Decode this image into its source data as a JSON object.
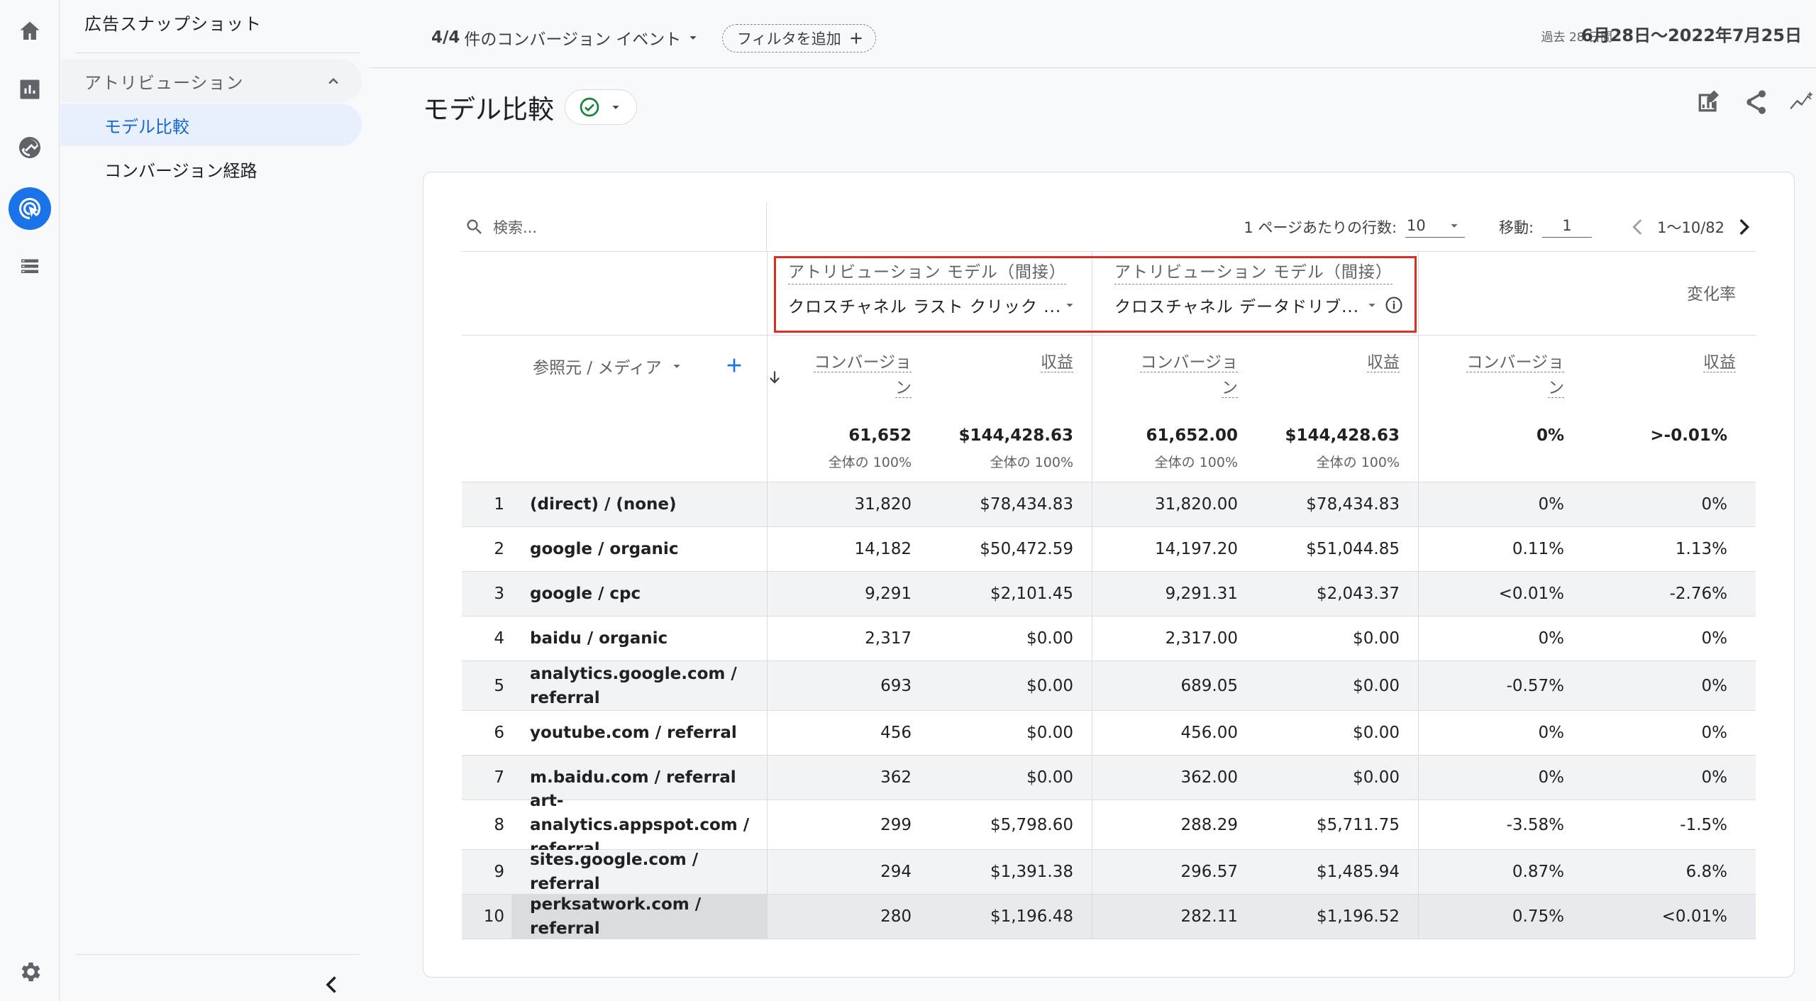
{
  "colors": {
    "accent": "#1a73e8",
    "highlight_frame": "#d93025",
    "active_nav_bg": "#e8f0fe"
  },
  "rail": {
    "icons": [
      "home-icon",
      "reports-icon",
      "explore-icon",
      "advertising-icon",
      "configure-icon",
      "admin-gear-icon"
    ]
  },
  "subnav": {
    "top_item": "広告スナップショット",
    "group_label": "アトリビューション",
    "items": [
      {
        "label": "モデル比較",
        "active": true
      },
      {
        "label": "コンバージョン経路",
        "active": false
      }
    ]
  },
  "filterbar": {
    "conv_count": "4/4",
    "conv_text": "件のコンバージョン イベント",
    "add_filter": "フィルタを追加",
    "date_label": "過去 28 日間",
    "date_range": "6月28日〜2022年7月25日"
  },
  "page": {
    "title": "モデル比較"
  },
  "table": {
    "search_placeholder": "検索...",
    "rows_per_page_label": "1 ページあたりの行数:",
    "rows_per_page": "10",
    "goto_label": "移動:",
    "goto_value": "1",
    "range": "1〜10/82",
    "model1": {
      "label": "アトリビューション モデル（間接）",
      "value": "クロスチャネル ラスト クリック ..."
    },
    "model2": {
      "label": "アトリビューション モデル（間接）",
      "value": "クロスチャネル データドリブ..."
    },
    "change_label": "変化率",
    "dimension": "参照元 / メディア",
    "metrics": {
      "conv": "コンバージョン",
      "conv_line1": "コンバージョ",
      "conv_line2": "ン",
      "rev": "収益"
    },
    "totals": {
      "conv1": "61,652",
      "rev1": "$144,428.63",
      "conv2": "61,652.00",
      "rev2": "$144,428.63",
      "chg_conv": "0%",
      "chg_rev": ">-0.01%",
      "pct": "全体の 100%"
    },
    "rows": [
      {
        "i": "1",
        "dim": "(direct) / (none)",
        "c1": "31,820",
        "r1": "$78,434.83",
        "c2": "31,820.00",
        "r2": "$78,434.83",
        "dc": "0%",
        "dr": "0%"
      },
      {
        "i": "2",
        "dim": "google / organic",
        "c1": "14,182",
        "r1": "$50,472.59",
        "c2": "14,197.20",
        "r2": "$51,044.85",
        "dc": "0.11%",
        "dr": "1.13%"
      },
      {
        "i": "3",
        "dim": "google / cpc",
        "c1": "9,291",
        "r1": "$2,101.45",
        "c2": "9,291.31",
        "r2": "$2,043.37",
        "dc": "<0.01%",
        "dr": "-2.76%"
      },
      {
        "i": "4",
        "dim": "baidu / organic",
        "c1": "2,317",
        "r1": "$0.00",
        "c2": "2,317.00",
        "r2": "$0.00",
        "dc": "0%",
        "dr": "0%"
      },
      {
        "i": "5",
        "dim": "analytics.google.com / referral",
        "c1": "693",
        "r1": "$0.00",
        "c2": "689.05",
        "r2": "$0.00",
        "dc": "-0.57%",
        "dr": "0%"
      },
      {
        "i": "6",
        "dim": "youtube.com / referral",
        "c1": "456",
        "r1": "$0.00",
        "c2": "456.00",
        "r2": "$0.00",
        "dc": "0%",
        "dr": "0%"
      },
      {
        "i": "7",
        "dim": "m.baidu.com / referral",
        "c1": "362",
        "r1": "$0.00",
        "c2": "362.00",
        "r2": "$0.00",
        "dc": "0%",
        "dr": "0%"
      },
      {
        "i": "8",
        "dim": "art-analytics.appspot.com / referral",
        "c1": "299",
        "r1": "$5,798.60",
        "c2": "288.29",
        "r2": "$5,711.75",
        "dc": "-3.58%",
        "dr": "-1.5%"
      },
      {
        "i": "9",
        "dim": "sites.google.com / referral",
        "c1": "294",
        "r1": "$1,391.38",
        "c2": "296.57",
        "r2": "$1,485.94",
        "dc": "0.87%",
        "dr": "6.8%"
      },
      {
        "i": "10",
        "dim": "perksatwork.com / referral",
        "c1": "280",
        "r1": "$1,196.48",
        "c2": "282.11",
        "r2": "$1,196.52",
        "dc": "0.75%",
        "dr": "<0.01%"
      }
    ]
  }
}
